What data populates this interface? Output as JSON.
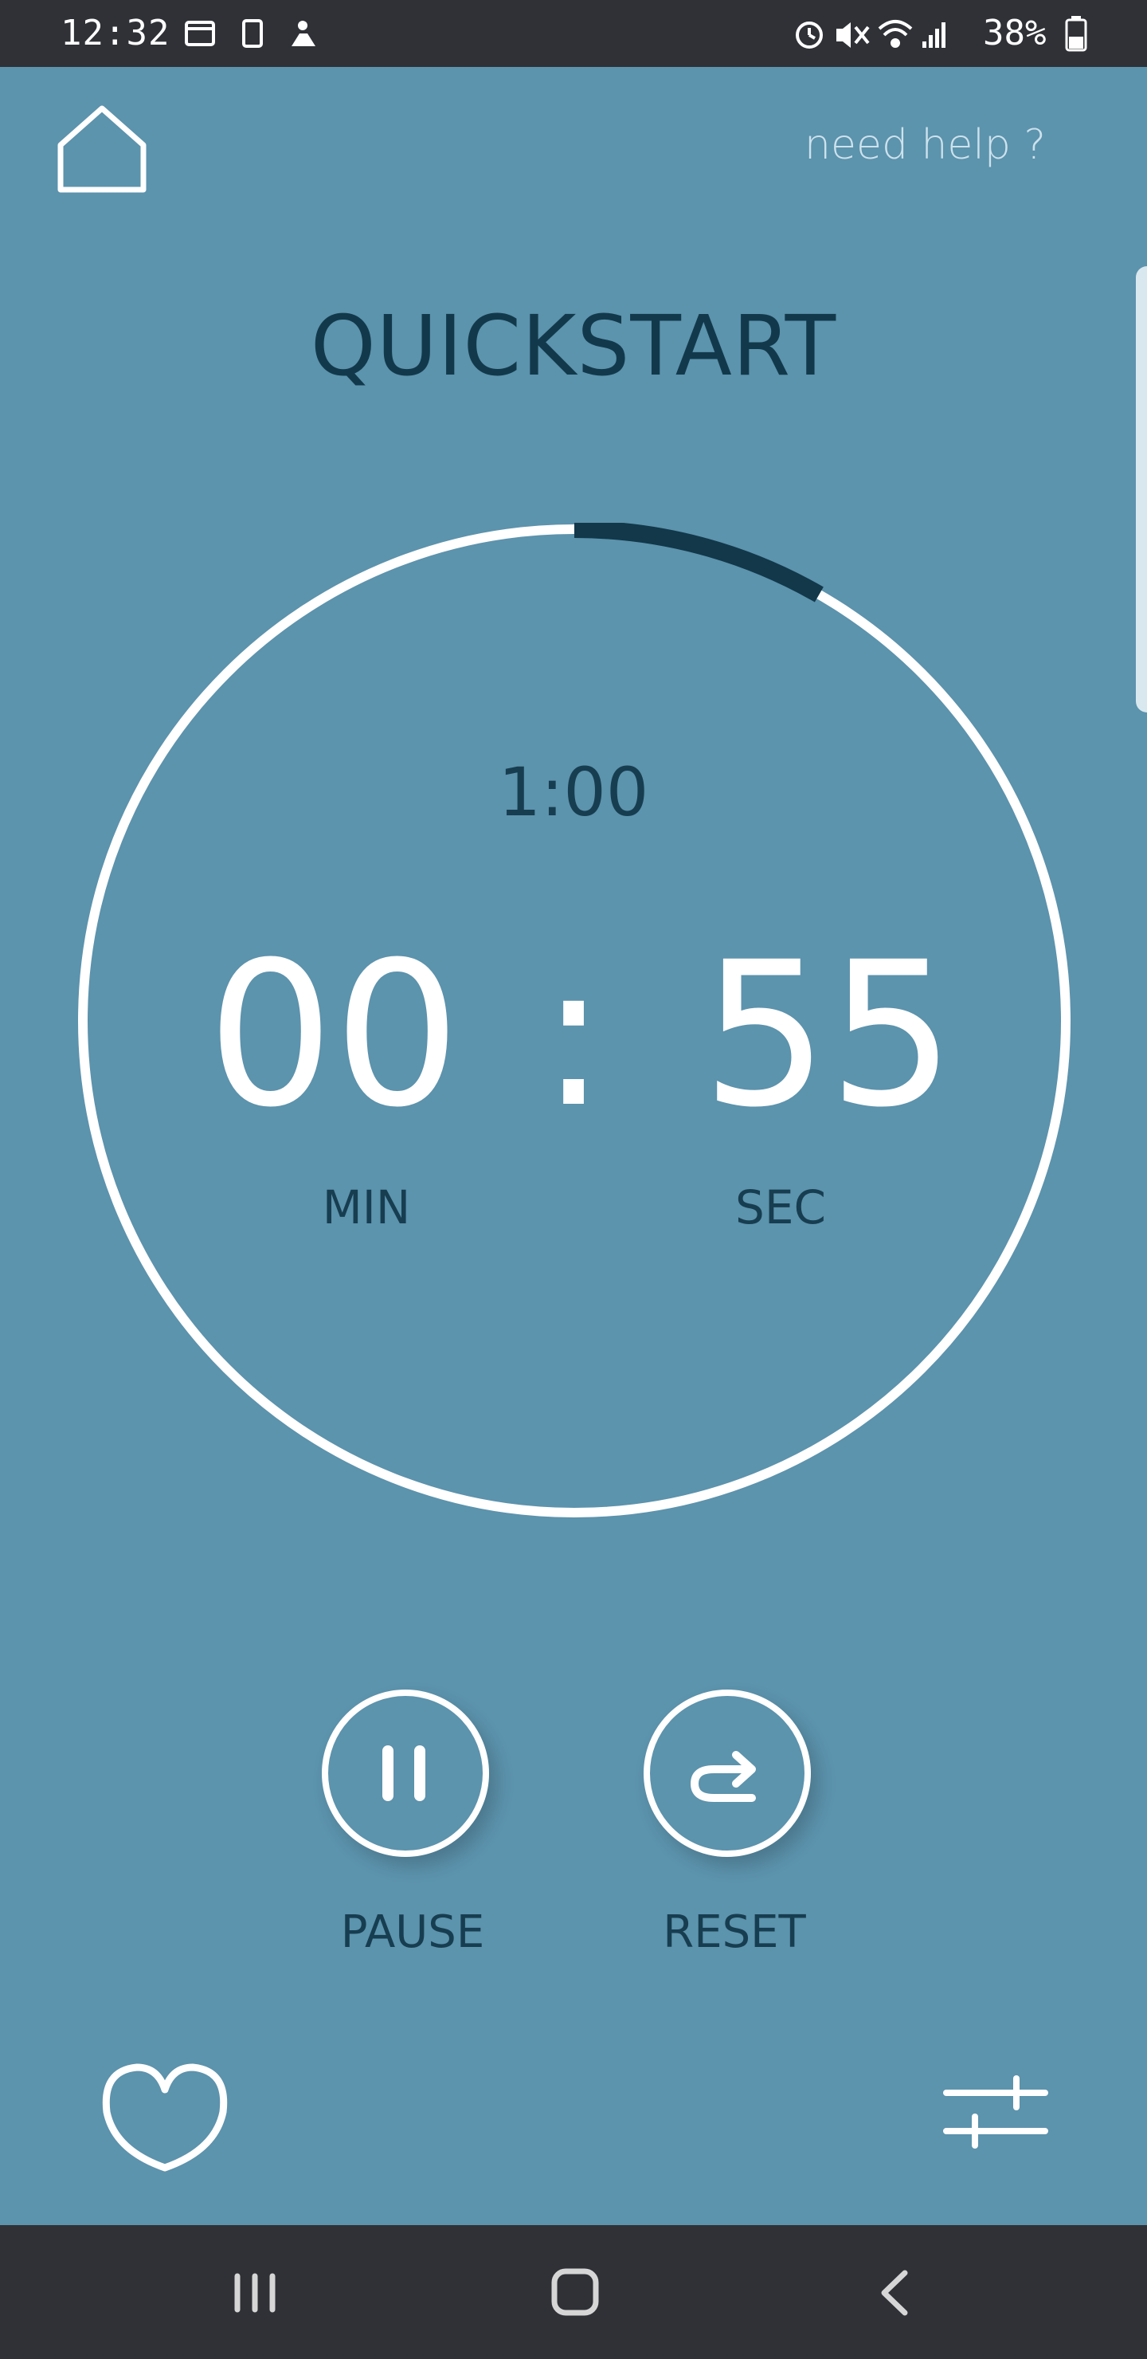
{
  "status_bar": {
    "time": "12:32",
    "battery": "38%",
    "left_icons": [
      "gallery-icon",
      "phone-icon",
      "notification-icon"
    ],
    "right_icons": [
      "alarm-icon",
      "mute-icon",
      "wifi-icon",
      "signal-icon",
      "battery-icon"
    ]
  },
  "header": {
    "help_label": "need help ?",
    "home_icon": "home-icon"
  },
  "page": {
    "title": "QUICKSTART"
  },
  "timer": {
    "total": "1:00",
    "minutes": "00",
    "separator": ":",
    "seconds": "55",
    "min_label": "MIN",
    "sec_label": "SEC",
    "elapsed_fraction": 0.083,
    "ring_color": "#ffffff",
    "progress_color": "#12384a"
  },
  "controls": {
    "pause_label": "PAUSE",
    "reset_label": "RESET",
    "pause_icon": "pause-icon",
    "reset_icon": "redo-icon"
  },
  "bottom": {
    "favorite_icon": "heart-icon",
    "settings_icon": "sliders-icon"
  },
  "nav": {
    "icons": [
      "recent-apps-icon",
      "home-icon",
      "back-icon"
    ]
  },
  "colors": {
    "background": "#5c93ad",
    "title_text": "#12394b",
    "system_bar": "#2f3136"
  }
}
